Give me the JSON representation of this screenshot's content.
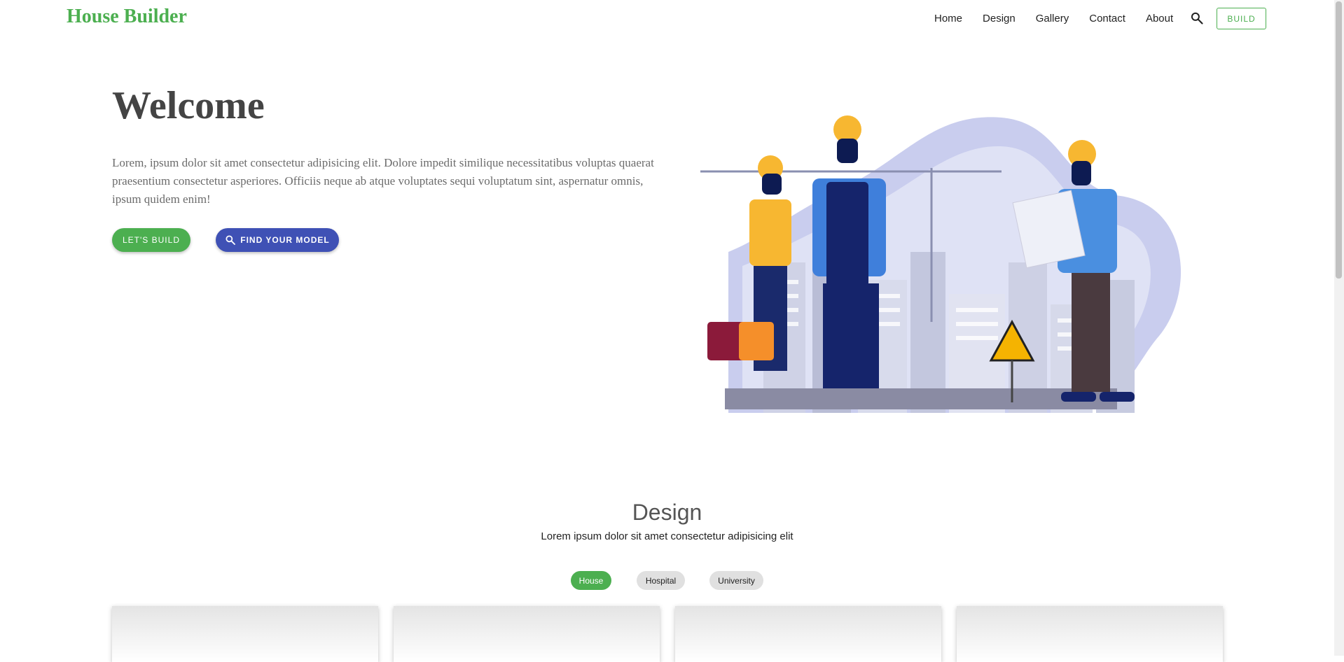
{
  "header": {
    "brand": "House Builder",
    "nav": [
      "Home",
      "Design",
      "Gallery",
      "Contact",
      "About"
    ],
    "build_label": "BUILD"
  },
  "hero": {
    "title": "Welcome",
    "text": "Lorem, ipsum dolor sit amet consectetur adipisicing elit. Dolore impedit similique necessitatibus voluptas quaerat praesentium consectetur asperiores. Officiis neque ab atque voluptates sequi voluptatum sint, aspernatur omnis, ipsum quidem enim!",
    "primary_btn": "LET'S BUILD",
    "secondary_btn": "FIND YOUR MODEL"
  },
  "design": {
    "title": "Design",
    "subtitle": "Lorem ipsum dolor sit amet consectetur adipisicing elit",
    "filters": [
      "House",
      "Hospital",
      "University"
    ],
    "active_filter": "House"
  },
  "colors": {
    "brand": "#4caf50",
    "secondary": "#3f51b5",
    "chip_inactive": "#e0e0e0"
  },
  "icons": {
    "search": "search-icon"
  }
}
